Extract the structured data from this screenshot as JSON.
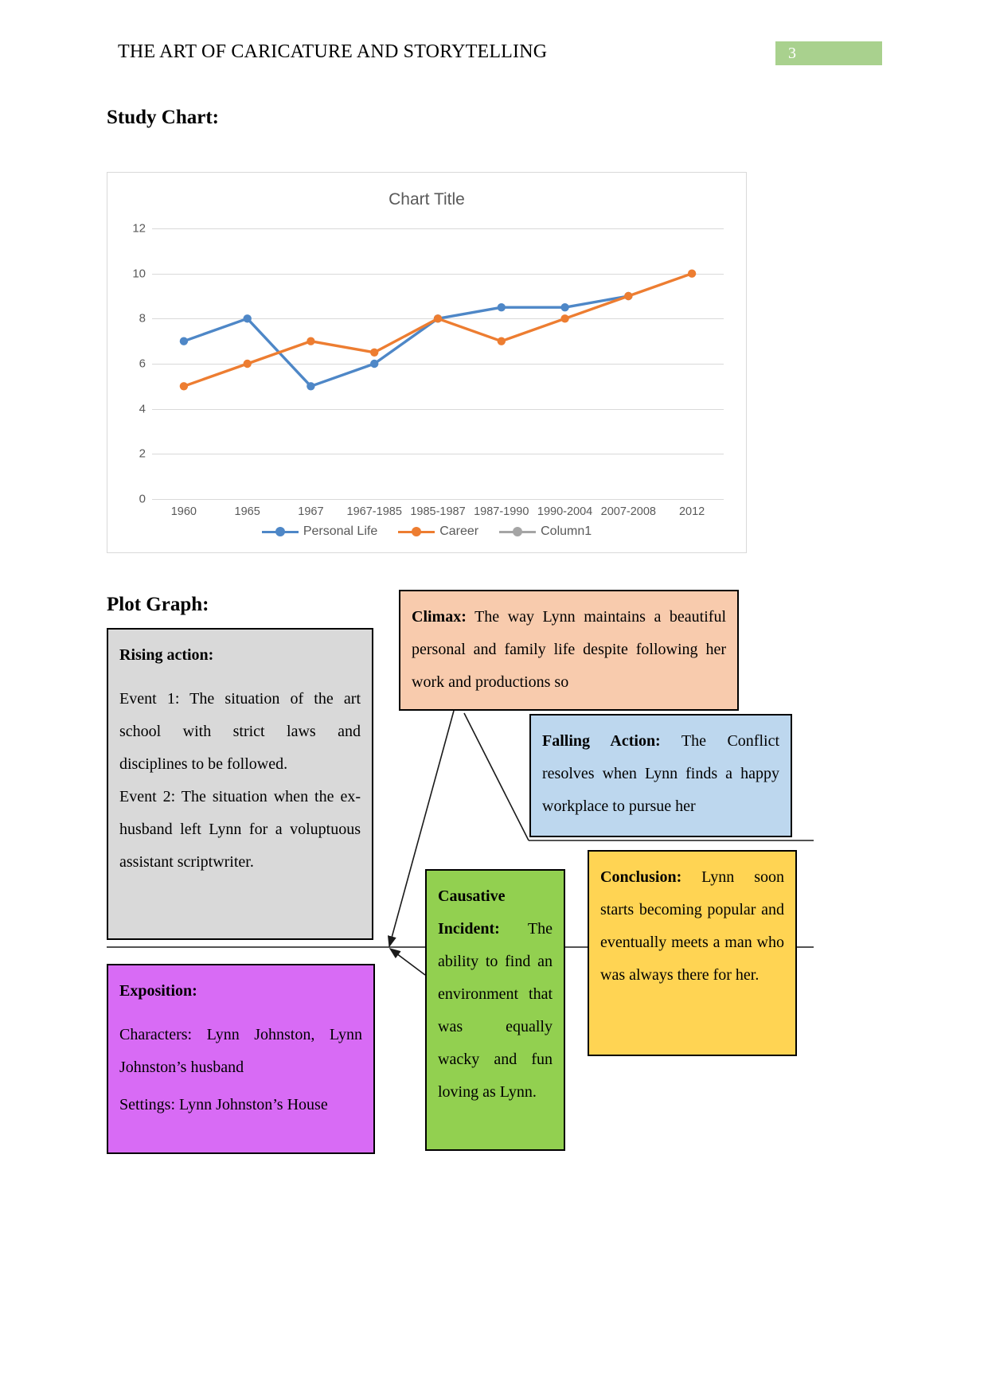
{
  "header": {
    "title": "THE ART OF CARICATURE AND STORYTELLING",
    "page_number": "3",
    "badge_color": "#A9D18E"
  },
  "sections": {
    "study_chart_heading": "Study Chart:",
    "plot_graph_heading": "Plot Graph:"
  },
  "chart_data": {
    "type": "line",
    "title": "Chart Title",
    "xlabel": "",
    "ylabel": "",
    "ylim": [
      0,
      12
    ],
    "yticks": [
      "0",
      "2",
      "4",
      "6",
      "8",
      "10",
      "12"
    ],
    "grid": true,
    "legend_position": "bottom",
    "categories": [
      "1960",
      "1965",
      "1967",
      "1967-1985",
      "1985-1987",
      "1987-1990",
      "1990-2004",
      "2007-2008",
      "2012"
    ],
    "series": [
      {
        "name": "Personal Life",
        "color": "#4E87C7",
        "values": [
          7,
          8,
          5,
          6,
          8,
          8.5,
          8.5,
          9,
          null
        ]
      },
      {
        "name": "Career",
        "color": "#ED7D31",
        "values": [
          5,
          6,
          7,
          6.5,
          8,
          7,
          8,
          9,
          10
        ]
      },
      {
        "name": "Column1",
        "color": "#A5A5A5",
        "values": []
      }
    ]
  },
  "plot_graph": {
    "rising": {
      "title": "Rising action:",
      "event1": "Event 1: The situation of the art school with strict laws and disciplines to be followed.",
      "event2": "Event 2: The situation when the ex-husband left Lynn for a voluptuous assistant scriptwriter.",
      "bg_color": "#D9D9D9"
    },
    "climax": {
      "title": "Climax:",
      "text": "The way Lynn maintains a beautiful personal and family life despite following her work and productions so",
      "bg_color": "#F8CBAD"
    },
    "falling": {
      "title": "Falling Action:",
      "text": "The Conflict resolves when Lynn finds a happy workplace to pursue her",
      "bg_color": "#BDD7EE"
    },
    "exposition": {
      "title": "Exposition:",
      "characters": "Characters: Lynn Johnston, Lynn Johnston’s husband",
      "settings": "Settings: Lynn Johnston’s House",
      "bg_color": "#D86BF5"
    },
    "causative": {
      "title_line1": "Causative",
      "title_line2": "Incident:",
      "text": "The ability to find an environment that was equally wacky and fun loving as Lynn.",
      "bg_color": "#92D050"
    },
    "conclusion": {
      "title": "Conclusion:",
      "text": "Lynn soon starts becoming popular and eventually meets a man who was always there for her.",
      "bg_color": "#FFD453"
    }
  }
}
